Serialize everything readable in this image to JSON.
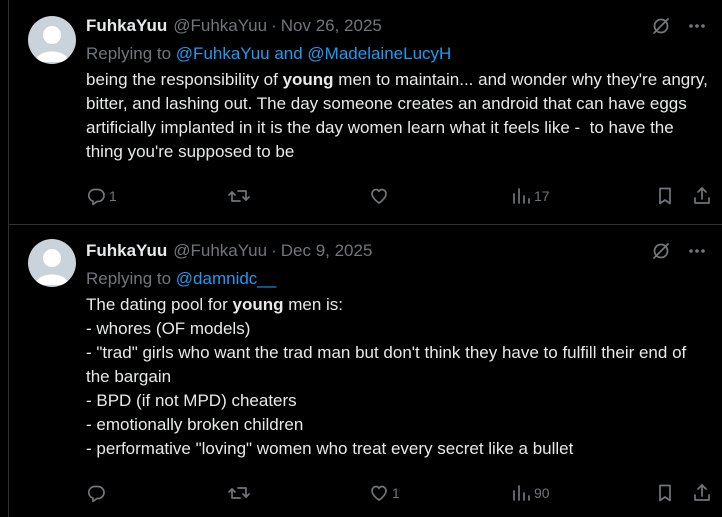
{
  "tweets": [
    {
      "author": {
        "name": "FuhkaYuu",
        "handle": "@FuhkaYuu"
      },
      "date": "Nov 26, 2025",
      "replying_prefix": "Replying to",
      "replying_to": "@FuhkaYuu and @MadelaineLucyH",
      "body": {
        "before": "being the responsibility of ",
        "bold": "young",
        "after": " men to maintain... and wonder why they're angry, bitter, and lashing out. The day someone creates an android that can have eggs artificially implanted in it is the day women learn what it feels like -  to have the thing you're supposed to be"
      },
      "stats": {
        "replies": "1",
        "reposts": "",
        "likes": "",
        "views": "17"
      }
    },
    {
      "author": {
        "name": "FuhkaYuu",
        "handle": "@FuhkaYuu"
      },
      "date": "Dec 9, 2025",
      "replying_prefix": "Replying to",
      "replying_to": "@damnidc__",
      "body": {
        "before": "The dating pool for ",
        "bold": "young",
        "after": " men is:\n- whores (OF models)\n- \"trad\" girls who want the trad man but don't think they have to fulfill their end of the bargain\n- BPD (if not MPD) cheaters\n- emotionally broken children\n- performative \"loving\" women who treat every secret like a bullet"
      },
      "stats": {
        "replies": "",
        "reposts": "",
        "likes": "1",
        "views": "90"
      }
    }
  ],
  "separator": "·",
  "icons": [
    "avatar",
    "grok-icon",
    "more-icon",
    "reply-icon",
    "repost-icon",
    "like-icon",
    "views-icon",
    "bookmark-icon",
    "share-icon"
  ],
  "colors": {
    "background": "#000000",
    "text": "#e7e9ea",
    "muted": "#71767b",
    "link": "#1d9bf0",
    "border": "#2f3336"
  }
}
